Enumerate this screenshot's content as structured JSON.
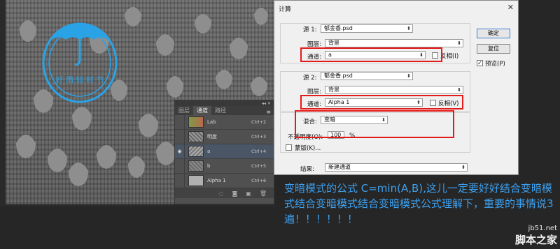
{
  "channels_panel": {
    "tabs": [
      "图层",
      "通道",
      "路径"
    ],
    "active_tab": 1,
    "rows": [
      {
        "name": "Lab",
        "shortcut": "Ctrl+2",
        "thumb": "#7a8c5a",
        "visible": false,
        "selected": false
      },
      {
        "name": "明度",
        "shortcut": "Ctrl+3",
        "thumb": "#8a8a8a",
        "visible": false,
        "selected": false
      },
      {
        "name": "a",
        "shortcut": "Ctrl+4",
        "thumb": "#9a9a9a",
        "visible": true,
        "selected": true
      },
      {
        "name": "b",
        "shortcut": "Ctrl+5",
        "thumb": "#7e7e7e",
        "visible": false,
        "selected": false
      },
      {
        "name": "Alpha 1",
        "shortcut": "Ctrl+6",
        "thumb": "#a8a8a8",
        "visible": false,
        "selected": false
      }
    ],
    "eye_icon": "◉",
    "menu_icon": "≡"
  },
  "dialog": {
    "title": "计算",
    "close": "✕",
    "source1": {
      "label": "源 1:",
      "file": "郁金香.psd",
      "layer_label": "图层:",
      "layer": "背景",
      "channel_label": "通道:",
      "channel": "a",
      "invert_label": "反相(I)"
    },
    "source2": {
      "label": "源 2:",
      "file": "郁金香.psd",
      "layer_label": "图层:",
      "layer": "背景",
      "channel_label": "通道:",
      "channel": "Alpha 1",
      "invert_label": "反相(V)"
    },
    "blend": {
      "label": "混合:",
      "mode": "变暗",
      "opacity_label": "不透明度(O):",
      "opacity": "100",
      "unit": "%",
      "mask_label": "蒙版(K)..."
    },
    "result": {
      "label": "结果:",
      "value": "新建通道"
    },
    "buttons": {
      "ok": "确定",
      "reset": "复位",
      "preview": "预览(P)"
    }
  },
  "stamp_text": "好 雨 知 时 节",
  "caption": "变暗模式的公式    C=min(A,B),这儿一定要好好结合变暗模式结合变暗模式结合变暗模式公式理解下，重要的事情说3遍！！！！！！",
  "watermark": {
    "url": "jb51.net",
    "name": "脚本之家"
  }
}
